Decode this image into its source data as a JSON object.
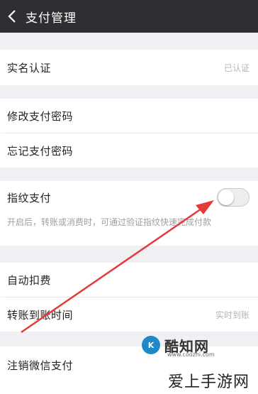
{
  "header": {
    "title": "支付管理",
    "back_icon": "chevron-left-icon"
  },
  "sections": {
    "realname": {
      "label": "实名认证",
      "value": "已认证"
    },
    "password": {
      "change_label": "修改支付密码",
      "forgot_label": "忘记支付密码"
    },
    "fingerprint": {
      "label": "指纹支付",
      "enabled": false,
      "description": "开启后，转账或消费时，可通过验证指纹快速完成付款"
    },
    "auto": {
      "auto_label": "自动扣费",
      "transfer_label": "转账到账时间",
      "transfer_value": "实时到账"
    },
    "cancel": {
      "label": "注销微信支付"
    }
  },
  "watermark": {
    "logo_icon_text": "K",
    "logo_text": "酷知网",
    "logo_url": "www.coozhi.com",
    "footer_text": "爱上手游网"
  },
  "colors": {
    "header_bg": "#2f2f33",
    "page_bg": "#efeff4",
    "annotation_arrow": "#e53935"
  }
}
